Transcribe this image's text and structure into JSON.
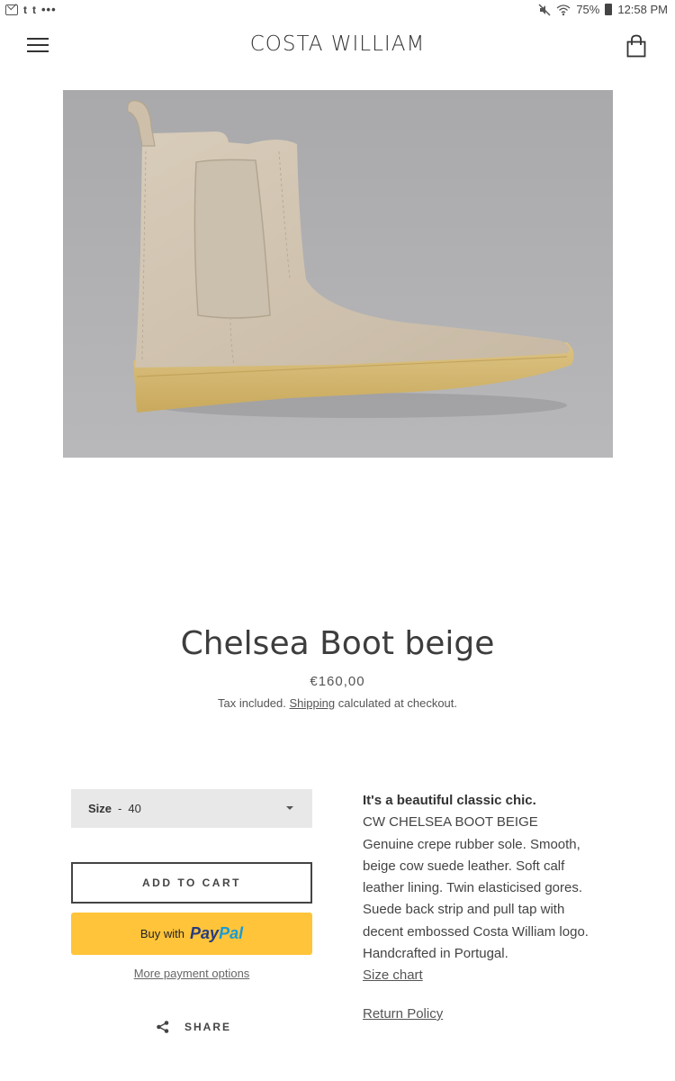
{
  "status_bar": {
    "left_icons": [
      "mail-icon",
      "tumblr-icon",
      "tumblr-icon",
      "more-dots-icon"
    ],
    "t1": "t",
    "t2": "t",
    "dots": "•••",
    "battery_percent": "75%",
    "time": "12:58 PM"
  },
  "header": {
    "logo": "COSTA WILLIAM",
    "menu_icon": "hamburger-icon",
    "cart_icon": "shopping-bag-icon"
  },
  "product": {
    "image_alt": "Chelsea Boot beige",
    "title": "Chelsea Boot beige",
    "price": "€160,00",
    "tax_prefix": "Tax included.",
    "shipping_link": "Shipping",
    "tax_suffix": "calculated at checkout."
  },
  "form": {
    "size_label": "Size",
    "size_separator": "-",
    "size_value": "40",
    "add_to_cart": "ADD TO CART",
    "paypal_prefix": "Buy with",
    "paypal_brand_1": "Pay",
    "paypal_brand_2": "Pal",
    "more_payment": "More payment options",
    "share": "SHARE"
  },
  "description": {
    "lead": "It's a beautiful classic chic.",
    "lines": [
      "CW CHELSEA BOOT BEIGE",
      "Genuine crepe rubber sole. Smooth,",
      "beige cow suede leather. Soft calf",
      "leather lining. Twin elasticised gores.",
      "Suede back strip and pull tap with",
      "decent embossed Costa William logo.",
      "Handcrafted in Portugal."
    ],
    "size_chart": "Size chart",
    "return_policy": "Return Policy"
  },
  "colors": {
    "paypal_yellow": "#ffc439",
    "paypal_dark_blue": "#253b80",
    "paypal_light_blue": "#179bd7",
    "select_bg": "#e8e8e8"
  }
}
